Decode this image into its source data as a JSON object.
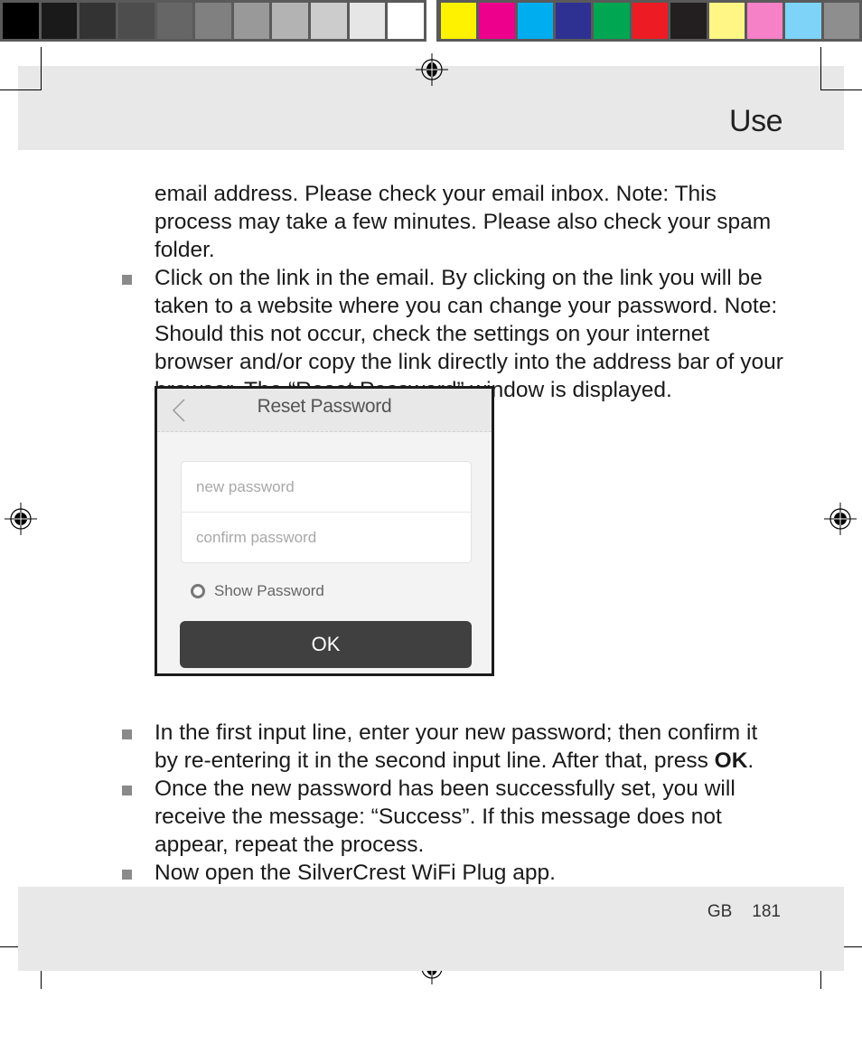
{
  "print_marks": {
    "grayscale_swatches": [
      "#000000",
      "#1a1a1a",
      "#333333",
      "#4d4d4d",
      "#666666",
      "#808080",
      "#999999",
      "#b3b3b3",
      "#cccccc",
      "#e6e6e6",
      "#ffffff"
    ],
    "color_swatches": [
      "#fff200",
      "#ec008c",
      "#00aeef",
      "#2e3192",
      "#00a651",
      "#ed1c24",
      "#231f20",
      "#fff685",
      "#f681c6",
      "#7dd4f8",
      "#8f8e8e"
    ]
  },
  "header": {
    "section_title": "Use"
  },
  "body": {
    "continuation": "email address. Please check your email inbox. Note: This process may take a few minutes. Please also check your spam folder.",
    "bullets_before": [
      "Click on the link in the email. By clicking on the link you will be taken to a website where you can change your password. Note: Should this not occur, check the settings on your internet browser and/or copy the link directly into the address bar of your browser. The “Reset Password” window is displayed."
    ],
    "bullet_ok": {
      "text_before": "In the first input line, enter your new password; then confirm it by re-entering it in the second input line. After that, press ",
      "bold": "OK",
      "text_after": "."
    },
    "bullets_after": [
      "Once the new password has been successfully set, you will receive the message: “Success”. If this message does not appear, repeat the process.",
      "Now open the SilverCrest WiFi Plug app."
    ]
  },
  "app_screen": {
    "title": "Reset Password",
    "back_icon": "chevron-left-icon",
    "new_password_placeholder": "new password",
    "confirm_password_placeholder": "confirm password",
    "show_password_label": "Show Password",
    "show_password_checked": false,
    "ok_label": "OK"
  },
  "footer": {
    "language": "GB",
    "page_number": "181"
  }
}
